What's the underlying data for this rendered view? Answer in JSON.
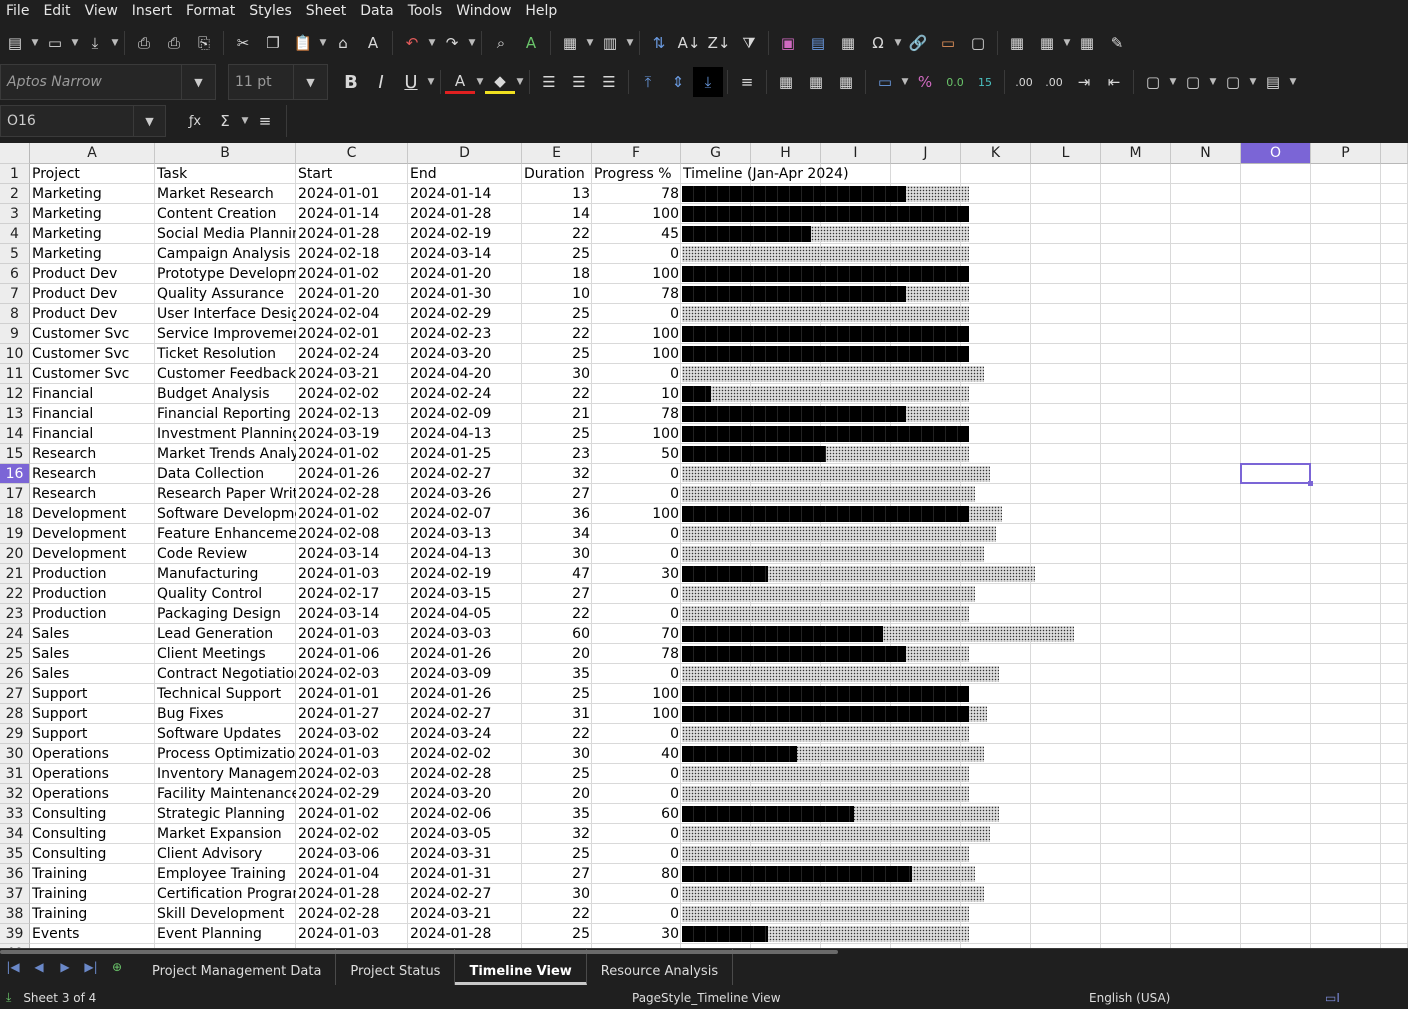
{
  "menu": [
    "File",
    "Edit",
    "View",
    "Insert",
    "Format",
    "Styles",
    "Sheet",
    "Data",
    "Tools",
    "Window",
    "Help"
  ],
  "toolbar": {
    "font_name": "Aptos Narrow",
    "font_size": "11 pt"
  },
  "formula_bar": {
    "cell_ref": "O16",
    "content": ""
  },
  "columns": [
    {
      "name": "A",
      "w": 125
    },
    {
      "name": "B",
      "w": 141
    },
    {
      "name": "C",
      "w": 112
    },
    {
      "name": "D",
      "w": 114
    },
    {
      "name": "E",
      "w": 70
    },
    {
      "name": "F",
      "w": 89
    },
    {
      "name": "G",
      "w": 70
    },
    {
      "name": "H",
      "w": 70
    },
    {
      "name": "I",
      "w": 70
    },
    {
      "name": "J",
      "w": 70
    },
    {
      "name": "K",
      "w": 70
    },
    {
      "name": "L",
      "w": 70
    },
    {
      "name": "M",
      "w": 70
    },
    {
      "name": "N",
      "w": 70
    },
    {
      "name": "O",
      "w": 70
    },
    {
      "name": "P",
      "w": 70
    },
    {
      "name": "",
      "w": 27
    }
  ],
  "selected": {
    "col": "O",
    "row": 16
  },
  "headers": [
    "Project",
    "Task",
    "Start",
    "End",
    "Duration",
    "Progress %",
    "Timeline (Jan-Apr 2024)"
  ],
  "rows": [
    [
      "Marketing",
      "Market Research",
      "2024-01-01",
      "2024-01-14",
      13,
      78
    ],
    [
      "Marketing",
      "Content Creation",
      "2024-01-14",
      "2024-01-28",
      14,
      100
    ],
    [
      "Marketing",
      "Social Media Planning",
      "2024-01-28",
      "2024-02-19",
      22,
      45
    ],
    [
      "Marketing",
      "Campaign Analysis",
      "2024-02-18",
      "2024-03-14",
      25,
      0
    ],
    [
      "Product Dev",
      "Prototype Development",
      "2024-01-02",
      "2024-01-20",
      18,
      100
    ],
    [
      "Product Dev",
      "Quality Assurance",
      "2024-01-20",
      "2024-01-30",
      10,
      78
    ],
    [
      "Product Dev",
      "User Interface Design",
      "2024-02-04",
      "2024-02-29",
      25,
      0
    ],
    [
      "Customer Svc",
      "Service Improvement",
      "2024-02-01",
      "2024-02-23",
      22,
      100
    ],
    [
      "Customer Svc",
      "Ticket Resolution",
      "2024-02-24",
      "2024-03-20",
      25,
      100
    ],
    [
      "Customer Svc",
      "Customer Feedback",
      "2024-03-21",
      "2024-04-20",
      30,
      0
    ],
    [
      "Financial",
      "Budget Analysis",
      "2024-02-02",
      "2024-02-24",
      22,
      10
    ],
    [
      "Financial",
      "Financial Reporting",
      "2024-02-13",
      "2024-02-09",
      21,
      78
    ],
    [
      "Financial",
      "Investment Planning",
      "2024-03-19",
      "2024-04-13",
      25,
      100
    ],
    [
      "Research",
      "Market Trends Analysis",
      "2024-01-02",
      "2024-01-25",
      23,
      50
    ],
    [
      "Research",
      "Data Collection",
      "2024-01-26",
      "2024-02-27",
      32,
      0
    ],
    [
      "Research",
      "Research Paper Writing",
      "2024-02-28",
      "2024-03-26",
      27,
      0
    ],
    [
      "Development",
      "Software Development",
      "2024-01-02",
      "2024-02-07",
      36,
      100
    ],
    [
      "Development",
      "Feature Enhancement",
      "2024-02-08",
      "2024-03-13",
      34,
      0
    ],
    [
      "Development",
      "Code Review",
      "2024-03-14",
      "2024-04-13",
      30,
      0
    ],
    [
      "Production",
      "Manufacturing",
      "2024-01-03",
      "2024-02-19",
      47,
      30
    ],
    [
      "Production",
      "Quality Control",
      "2024-02-17",
      "2024-03-15",
      27,
      0
    ],
    [
      "Production",
      "Packaging Design",
      "2024-03-14",
      "2024-04-05",
      22,
      0
    ],
    [
      "Sales",
      "Lead Generation",
      "2024-01-03",
      "2024-03-03",
      60,
      70
    ],
    [
      "Sales",
      "Client Meetings",
      "2024-01-06",
      "2024-01-26",
      20,
      78
    ],
    [
      "Sales",
      "Contract Negotiation",
      "2024-02-03",
      "2024-03-09",
      35,
      0
    ],
    [
      "Support",
      "Technical Support",
      "2024-01-01",
      "2024-01-26",
      25,
      100
    ],
    [
      "Support",
      "Bug Fixes",
      "2024-01-27",
      "2024-02-27",
      31,
      100
    ],
    [
      "Support",
      "Software Updates",
      "2024-03-02",
      "2024-03-24",
      22,
      0
    ],
    [
      "Operations",
      "Process Optimization",
      "2024-01-03",
      "2024-02-02",
      30,
      40
    ],
    [
      "Operations",
      "Inventory Management",
      "2024-02-03",
      "2024-02-28",
      25,
      0
    ],
    [
      "Operations",
      "Facility Maintenance",
      "2024-02-29",
      "2024-03-20",
      20,
      0
    ],
    [
      "Consulting",
      "Strategic Planning",
      "2024-01-02",
      "2024-02-06",
      35,
      60
    ],
    [
      "Consulting",
      "Market Expansion",
      "2024-02-02",
      "2024-03-05",
      32,
      0
    ],
    [
      "Consulting",
      "Client Advisory",
      "2024-03-06",
      "2024-03-31",
      25,
      0
    ],
    [
      "Training",
      "Employee Training",
      "2024-01-04",
      "2024-01-31",
      27,
      80
    ],
    [
      "Training",
      "Certification Program",
      "2024-01-28",
      "2024-02-27",
      30,
      0
    ],
    [
      "Training",
      "Skill Development",
      "2024-02-28",
      "2024-03-21",
      22,
      0
    ],
    [
      "Events",
      "Event Planning",
      "2024-01-03",
      "2024-01-28",
      25,
      30
    ]
  ],
  "sheet_tabs": [
    "Project Management Data",
    "Project Status",
    "Timeline View",
    "Resource Analysis"
  ],
  "active_tab": "Timeline View",
  "status": {
    "sheet": "Sheet 3 of 4",
    "page_style": "PageStyle_Timeline View",
    "language": "English (USA)"
  }
}
